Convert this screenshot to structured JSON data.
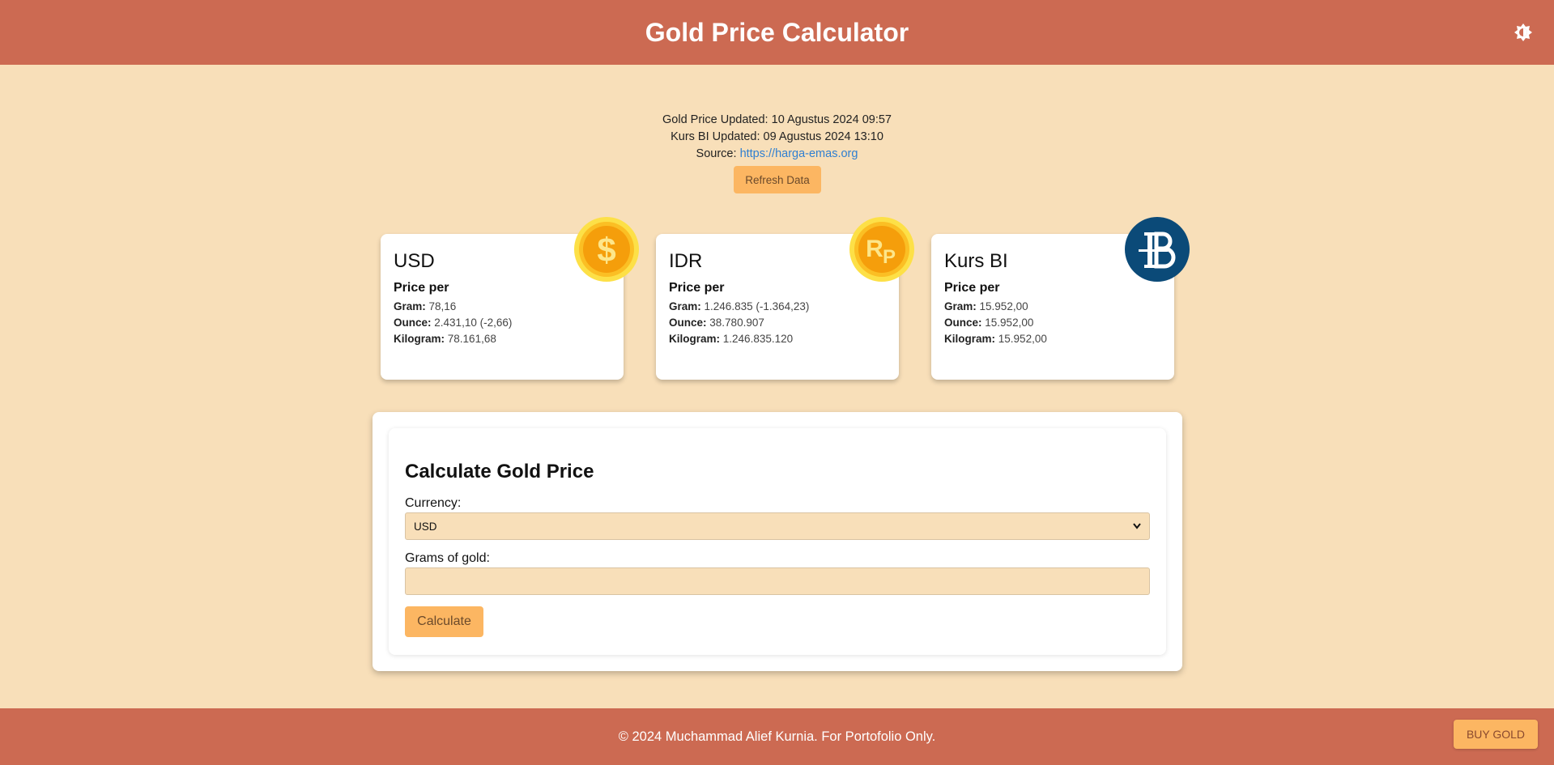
{
  "header": {
    "title": "Gold Price Calculator"
  },
  "info": {
    "gold_updated_label": "Gold Price Updated:",
    "gold_updated_value": "10 Agustus 2024 09:57",
    "kurs_updated_label": "Kurs BI Updated:",
    "kurs_updated_value": "09 Agustus 2024 13:10",
    "source_label": "Source:",
    "source_link": "https://harga-emas.org",
    "refresh_label": "Refresh Data"
  },
  "cards": [
    {
      "title": "USD",
      "subtitle": "Price per",
      "gram_label": "Gram:",
      "gram_value": "78,16",
      "ounce_label": "Ounce:",
      "ounce_value": "2.431,10 (-2,66)",
      "kg_label": "Kilogram:",
      "kg_value": "78.161,68",
      "icon": "dollar-coin-icon"
    },
    {
      "title": "IDR",
      "subtitle": "Price per",
      "gram_label": "Gram:",
      "gram_value": "1.246.835 (-1.364,23)",
      "ounce_label": "Ounce:",
      "ounce_value": "38.780.907",
      "kg_label": "Kilogram:",
      "kg_value": "1.246.835.120",
      "icon": "rupiah-coin-icon"
    },
    {
      "title": "Kurs BI",
      "subtitle": "Price per",
      "gram_label": "Gram:",
      "gram_value": "15.952,00",
      "ounce_label": "Ounce:",
      "ounce_value": "15.952,00",
      "kg_label": "Kilogram:",
      "kg_value": "15.952,00",
      "icon": "bank-indonesia-logo-icon"
    }
  ],
  "calculator": {
    "title": "Calculate Gold Price",
    "currency_label": "Currency:",
    "currency_value": "USD",
    "grams_label": "Grams of gold:",
    "grams_value": "",
    "calculate_label": "Calculate"
  },
  "footer": {
    "copyright": "© 2024 Muchammad Alief Kurnia. For Portofolio Only.",
    "buy_label": "BUY GOLD"
  },
  "colors": {
    "header_bg": "#cc6a52",
    "page_bg": "#f8dfb9",
    "button_bg": "#fcb662",
    "link": "#2f7fd1"
  }
}
